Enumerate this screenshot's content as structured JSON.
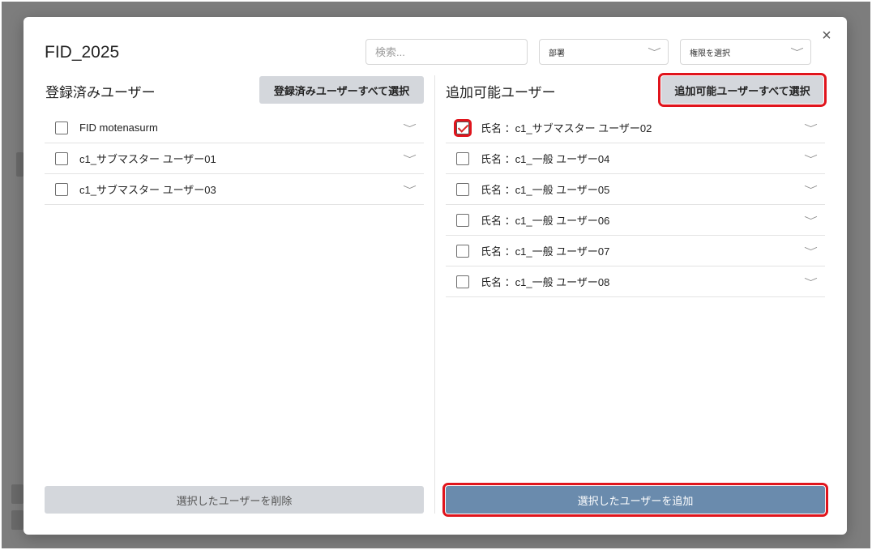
{
  "dialog": {
    "title": "FID_2025",
    "close_glyph": "×",
    "search_placeholder": "検索...",
    "department_select": "部署",
    "permission_select": "権限を選択"
  },
  "registered": {
    "heading": "登録済みユーザー",
    "select_all": "登録済みユーザーすべて選択",
    "users": [
      {
        "label": "FID motenasurm",
        "checked": false
      },
      {
        "label": "c1_サブマスター ユーザー01",
        "checked": false
      },
      {
        "label": "c1_サブマスター ユーザー03",
        "checked": false
      }
    ],
    "action": "選択したユーザーを削除"
  },
  "available": {
    "heading": "追加可能ユーザー",
    "select_all": "追加可能ユーザーすべて選択",
    "users": [
      {
        "label": "氏名 ：c1_サブマスター ユーザー02",
        "checked": true
      },
      {
        "label": "氏名 ：c1_一般 ユーザー04",
        "checked": false
      },
      {
        "label": "氏名 ：c1_一般 ユーザー05",
        "checked": false
      },
      {
        "label": "氏名 ：c1_一般 ユーザー06",
        "checked": false
      },
      {
        "label": "氏名 ：c1_一般 ユーザー07",
        "checked": false
      },
      {
        "label": "氏名 ：c1_一般 ユーザー08",
        "checked": false
      }
    ],
    "action": "選択したユーザーを追加"
  },
  "icons": {
    "chevron": "﹀",
    "close": "close-icon"
  },
  "colors": {
    "add_button": "#6a8bad",
    "highlight": "#e0141c",
    "secondary_button": "#d4d7dc"
  }
}
